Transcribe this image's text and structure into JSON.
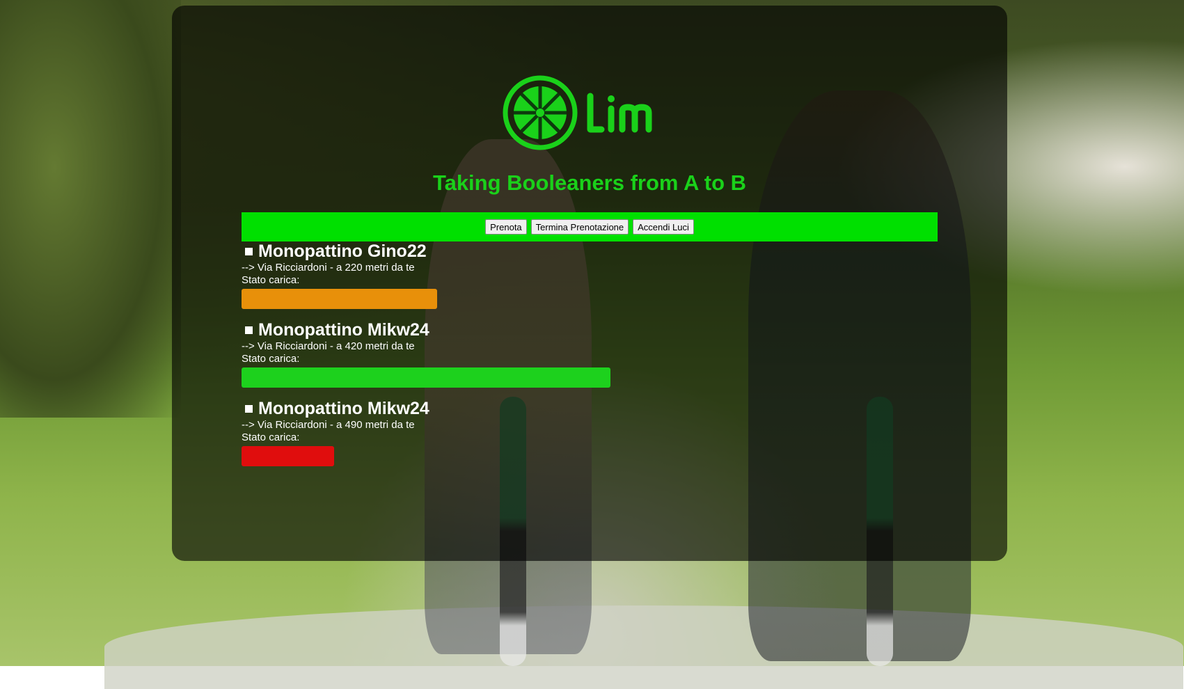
{
  "brand": {
    "name": "Lim",
    "tagline": "Taking Booleaners from A to B",
    "color": "#1ad11a"
  },
  "toolbar": {
    "buttons": [
      {
        "label": "Prenota"
      },
      {
        "label": "Termina Prenotazione"
      },
      {
        "label": "Accendi Luci"
      }
    ],
    "color": "#00e000"
  },
  "scooters": [
    {
      "name": "Monopattino Gino22",
      "location": "--> Via Ricciardoni - a 220 metri da te",
      "battery_label": "Stato carica:",
      "battery_level": 0.53,
      "battery_color": "#e8900a"
    },
    {
      "name": "Monopattino Mikw24",
      "location": "--> Via Ricciardoni - a 420 metri da te",
      "battery_label": "Stato carica:",
      "battery_level": 1.0,
      "battery_color": "#1dd11d"
    },
    {
      "name": "Monopattino Mikw24",
      "location": "--> Via Ricciardoni - a 490 metri da te",
      "battery_label": "Stato carica:",
      "battery_level": 0.25,
      "battery_color": "#e00d0d"
    }
  ]
}
